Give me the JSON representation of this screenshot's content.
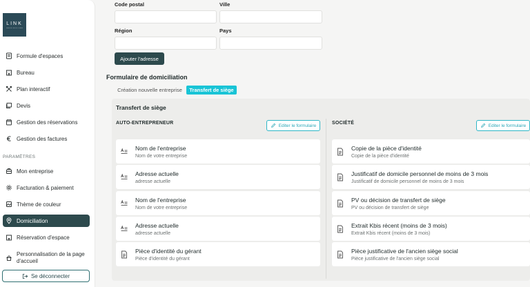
{
  "sidebar": {
    "logo": {
      "main": "LINK",
      "sub": "OFFICE SOLUTIONS"
    },
    "items": [
      {
        "label": "Formule d'espaces",
        "icon": "receipt-icon"
      },
      {
        "label": "Bureau",
        "icon": "building-icon"
      },
      {
        "label": "Plan interactif",
        "icon": "cross-arrows-icon"
      },
      {
        "label": "Devis",
        "icon": "stack-icon"
      },
      {
        "label": "Gestion des réservations",
        "icon": "calendar-icon"
      },
      {
        "label": "Gestion des factures",
        "icon": "euro-icon"
      }
    ],
    "section_label": "PARAMÈTRES",
    "settings": [
      {
        "label": "Mon entreprise",
        "icon": "briefcase-icon"
      },
      {
        "label": "Facturation & paiement",
        "icon": "gear-icon"
      },
      {
        "label": "Thème de couleur",
        "icon": "image-icon"
      },
      {
        "label": "Domiciliation",
        "icon": "location-icon",
        "active": true
      },
      {
        "label": "Réservation d'espace",
        "icon": "building-icon"
      },
      {
        "label": "Personnalisation de la page d'accueil",
        "icon": "home-icon"
      }
    ],
    "logout_label": "Se déconnecter"
  },
  "address_form": {
    "code_postal_label": "Code postal",
    "ville_label": "Ville",
    "region_label": "Région",
    "pays_label": "Pays",
    "code_postal_value": "",
    "ville_value": "",
    "region_value": "",
    "pays_value": "",
    "add_button": "Ajouter l'adresse"
  },
  "domiciliation": {
    "heading": "Formulaire de domiciliation",
    "tabs": [
      {
        "label": "Création nouvelle entreprise",
        "active": false
      },
      {
        "label": "Transfert de siège",
        "active": true
      }
    ],
    "panel_title": "Transfert de siège",
    "edit_label": "Editer le formulaire",
    "columns": [
      {
        "title": "AUTO-ENTREPRENEUR",
        "fields": [
          {
            "title": "Nom de l'entreprise",
            "sub": "Nom de votre entreprise",
            "icon": "text-icon"
          },
          {
            "title": "Adresse actuelle",
            "sub": "adresse actuelle",
            "icon": "text-icon"
          },
          {
            "title": "Nom de l'entreprise",
            "sub": "Nom de votre entreprise",
            "icon": "text-icon"
          },
          {
            "title": "Adresse actuelle",
            "sub": "adresse actuelle",
            "icon": "text-icon"
          },
          {
            "title": "Pièce d'identité du gérant",
            "sub": "Pièce d'identité du gérant",
            "icon": "document-icon"
          }
        ]
      },
      {
        "title": "SOCIÉTÉ",
        "fields": [
          {
            "title": "Copie de la pièce d'identité",
            "sub": "Copie de la pièce d'identité",
            "icon": "document-icon"
          },
          {
            "title": "Justificatif de domicile personnel de moins de 3 mois",
            "sub": "Justificatif de domicile personnel de moins de 3 mois",
            "icon": "document-icon"
          },
          {
            "title": "PV ou décision de transfert de siège",
            "sub": "PV ou décision de transfert de siège",
            "icon": "document-icon"
          },
          {
            "title": "Extrait Kbis récent (moins de 3 mois)",
            "sub": "Extrait Kbis récent (moins de 3 mois)",
            "icon": "document-icon"
          },
          {
            "title": "Pièce justificative de l'ancien siège social",
            "sub": "Pièce justificative de l'ancien siège social",
            "icon": "document-icon"
          }
        ]
      }
    ]
  }
}
